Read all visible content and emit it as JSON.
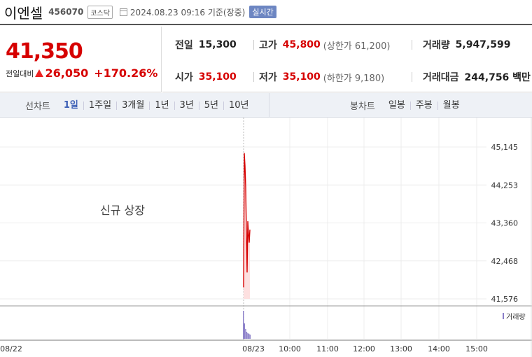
{
  "header": {
    "name": "이엔셀",
    "code": "456070",
    "market": "코스닥",
    "basis_time": "2024.08.23 09:16 기준(장중)",
    "realtime": "실시간"
  },
  "price": {
    "current": "41,350",
    "prev_label": "전일대비",
    "change": "26,050",
    "change_pct": "+170.26%"
  },
  "stats": {
    "prev_close_label": "전일",
    "prev_close": "15,300",
    "high_label": "고가",
    "high": "45,800",
    "upper_limit": "(상한가 61,200)",
    "volume_label": "거래량",
    "volume": "5,947,599",
    "open_label": "시가",
    "open": "35,100",
    "low_label": "저가",
    "low": "35,100",
    "lower_limit": "(하한가 9,180)",
    "amount_label": "거래대금",
    "amount": "244,756 백만"
  },
  "tabs": {
    "line_label": "선차트",
    "line_periods": [
      "1일",
      "1주일",
      "3개월",
      "1년",
      "3년",
      "5년",
      "10년"
    ],
    "candle_label": "봉차트",
    "candle_periods": [
      "일봉",
      "주봉",
      "월봉"
    ]
  },
  "colors": {
    "up": "#d60000",
    "accent": "#3b5eb5",
    "volume": "#8b7fc9"
  },
  "chart_data": {
    "type": "line",
    "annotation": "신규 상장",
    "y_ticks": [
      "45,145",
      "44,253",
      "43,360",
      "42,468",
      "41,576"
    ],
    "ylim": [
      41576,
      45145
    ],
    "x_ticks": [
      "08/22",
      "08/23",
      "10:00",
      "11:00",
      "12:00",
      "13:00",
      "14:00",
      "15:00"
    ],
    "volume_label": "거래량",
    "series": [
      {
        "values": [
          41850,
          45000,
          44700,
          44200,
          43100,
          42200,
          43400,
          43100,
          42900,
          43200
        ]
      }
    ],
    "volume": [
      1.0,
      0.55,
      0.35,
      0.25,
      0.2,
      0.18,
      0.15
    ]
  }
}
